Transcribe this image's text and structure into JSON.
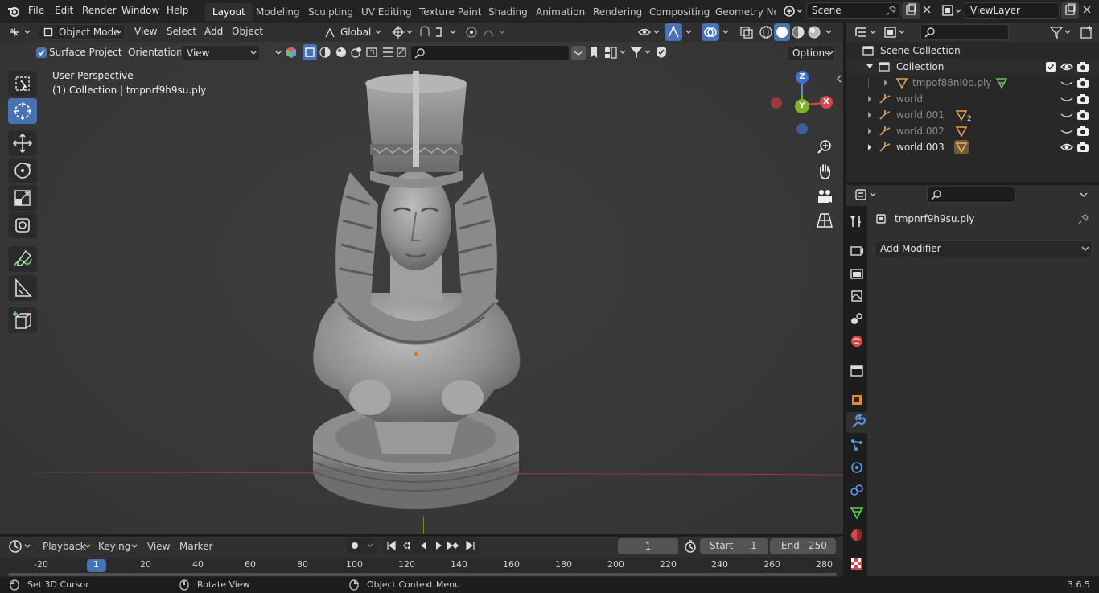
{
  "topbar": {
    "menus": [
      "File",
      "Edit",
      "Render",
      "Window",
      "Help"
    ],
    "workspaces": [
      "Layout",
      "Modeling",
      "Sculpting",
      "UV Editing",
      "Texture Paint",
      "Shading",
      "Animation",
      "Rendering",
      "Compositing",
      "Geometry Noc"
    ],
    "active_workspace": "Layout",
    "scene": "Scene",
    "view_layer": "ViewLayer"
  },
  "viewport": {
    "mode": "Object Mode",
    "menus": [
      "View",
      "Select",
      "Add",
      "Object"
    ],
    "transform_orientation": "Global",
    "surface_project": "Surface Project",
    "orientation_label": "Orientation:",
    "orientation_value": "View",
    "options": "Options",
    "overlay_title": "User Perspective",
    "overlay_sub": "(1) Collection | tmpnrf9h9su.ply",
    "gizmo": {
      "z": "Z",
      "x": "X",
      "y": "Y"
    },
    "accent": "#4772b3"
  },
  "outliner": {
    "root": "Scene Collection",
    "rows": [
      {
        "name": "Collection"
      },
      {
        "name": "tmpof88ni0o.ply"
      },
      {
        "name": "world"
      },
      {
        "name": "world.001",
        "badge": "2"
      },
      {
        "name": "world.002"
      },
      {
        "name": "world.003"
      }
    ]
  },
  "properties": {
    "object": "tmpnrf9h9su.ply",
    "add_modifier": "Add Modifier"
  },
  "timeline": {
    "menus": [
      "Playback",
      "Keying",
      "View",
      "Marker"
    ],
    "current_frame": "1",
    "start_label": "Start",
    "start": "1",
    "end_label": "End",
    "end": "250",
    "ruler": [
      "-20",
      "1",
      "20",
      "40",
      "60",
      "80",
      "100",
      "120",
      "140",
      "160",
      "180",
      "200",
      "220",
      "240",
      "260",
      "280"
    ]
  },
  "status": {
    "hints": [
      "Set 3D Cursor",
      "Rotate View",
      "Object Context Menu"
    ],
    "version": "3.6.5"
  }
}
